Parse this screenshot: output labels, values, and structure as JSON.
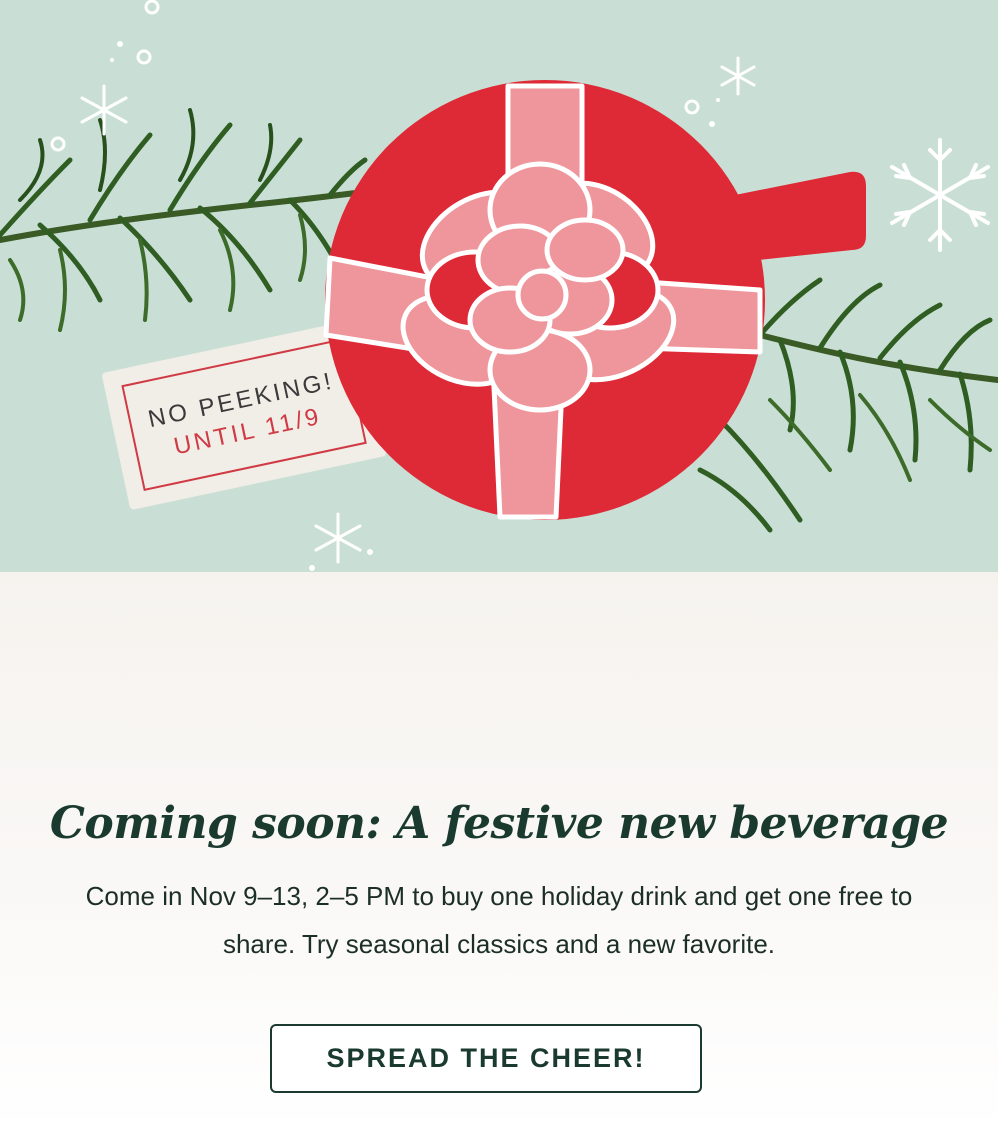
{
  "hero": {
    "tag_line1": "NO PEEKING!",
    "tag_line2": "UNTIL 11/9"
  },
  "content": {
    "headline": "Coming soon: A festive new beverage",
    "body_line1": "Come in Nov 9–13, 2–5 PM to buy one holiday drink and get one free to",
    "body_line2": "share. Try seasonal classics and a new favorite.",
    "cta_label": "SPREAD THE CHEER!"
  },
  "colors": {
    "hero_background": "#c9dfd5",
    "cup_red": "#de2a36",
    "ribbon_pink": "#ee969b",
    "pine_green": "#2f5d22",
    "tag_red": "#d03a44",
    "text_dark_green": "#1b3a2f"
  }
}
